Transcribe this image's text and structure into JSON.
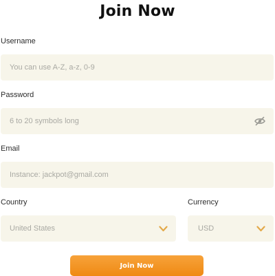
{
  "form": {
    "title": "Join Now",
    "username": {
      "label": "Username",
      "placeholder": "You can use A-Z, a-z, 0-9",
      "value": ""
    },
    "password": {
      "label": "Password",
      "placeholder": "6 to 20 symbols long",
      "value": "",
      "toggle_icon": "eye-slash-icon"
    },
    "email": {
      "label": "Email",
      "placeholder": "Instance: jackpot@gmail.com",
      "value": ""
    },
    "country": {
      "label": "Country",
      "selected": "United States",
      "icon": "chevron-down-icon"
    },
    "currency": {
      "label": "Currency",
      "selected": "USD",
      "icon": "chevron-down-icon"
    },
    "submit_label": "Join Now"
  },
  "colors": {
    "field_background": "#f7f5ea",
    "placeholder_text": "#a9a9a3",
    "accent_orange": "#ef8a14",
    "chevron": "#e3a94a",
    "eye_icon": "#9a9a94"
  }
}
